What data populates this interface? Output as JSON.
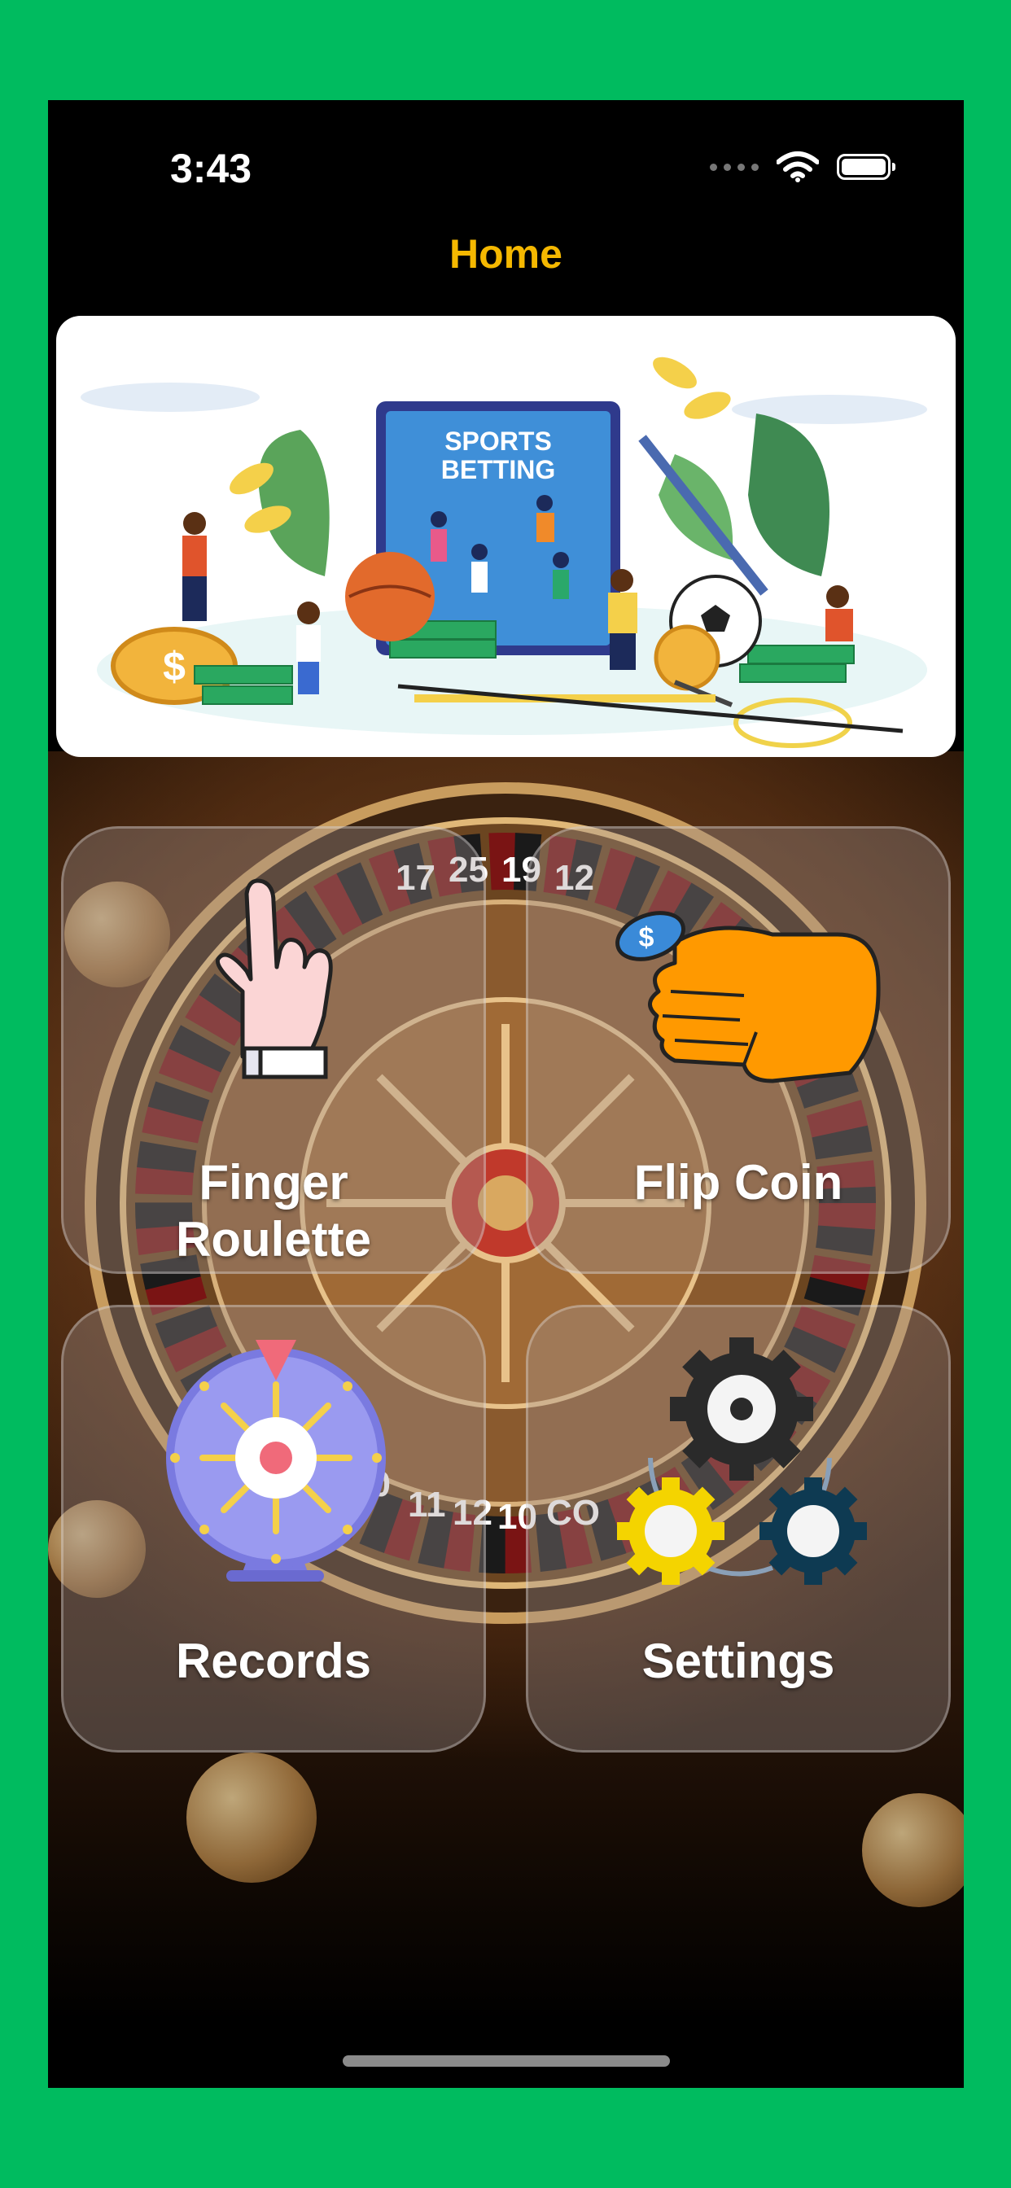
{
  "status_bar": {
    "time": "3:43"
  },
  "nav": {
    "title": "Home"
  },
  "banner": {
    "heading_line1": "SPORTS",
    "heading_line2": "BETTING",
    "coin_symbol": "$"
  },
  "tiles": [
    {
      "label_line1": "Finger",
      "label_line2": "Roulette",
      "icon": "hand-rock-icon"
    },
    {
      "label_line1": "Flip Coin",
      "label_line2": "",
      "icon": "hand-flip-coin-icon",
      "coin_symbol": "$"
    },
    {
      "label_line1": "Records",
      "label_line2": "",
      "icon": "prize-wheel-icon"
    },
    {
      "label_line1": "Settings",
      "label_line2": "",
      "icon": "gears-icon"
    }
  ],
  "wheel_numbers_top": [
    "17",
    "25",
    "19",
    "12"
  ],
  "wheel_numbers_bottom": [
    "30",
    "11",
    "12",
    "10",
    "CO"
  ],
  "colors": {
    "background": "#00bb5f",
    "title": "#f5b800",
    "coin_hand": "#ff9900"
  }
}
